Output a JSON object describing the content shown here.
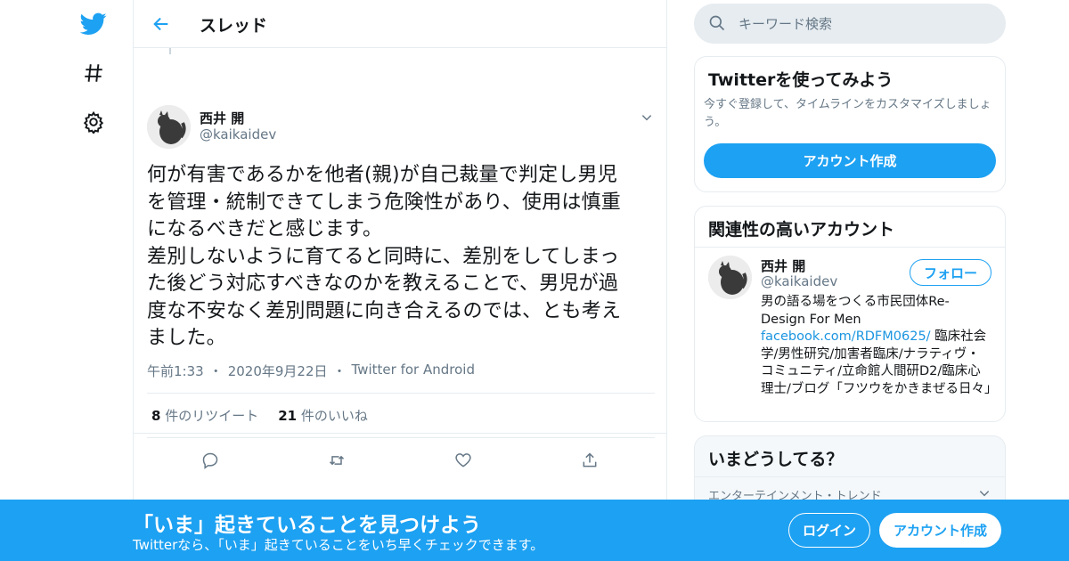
{
  "header": {
    "title": "スレッド"
  },
  "nav": {
    "icons": [
      "twitter-bird-icon",
      "hashtag-icon",
      "settings-gear-icon"
    ]
  },
  "tweet": {
    "author_name": "西井 開",
    "author_handle": "@kaikaidev",
    "text": "何が有害であるかを他者(親)が自己裁量で判定し男児\nを管理・統制できてしまう危険性があり、使用は慎重\nになるべきだと感じます。\n差別しないように育てると同時に、差別をしてしまっ\nた後どう対応すべきなのかを教えることで、男児が過\n度な不安なく差別問題に向き合えるのでは、とも考え\nました。",
    "time": "午前1:33",
    "date": "2020年9月22日",
    "source": "Twitter for Android",
    "sep": "・",
    "retweet_count": "8",
    "retweet_label": "件のリツイート",
    "like_count": "21",
    "like_label": "件のいいね"
  },
  "search": {
    "placeholder": "キーワード検索"
  },
  "signup_card": {
    "title": "Twitterを使ってみよう",
    "subtitle": "今すぐ登録して、タイムラインをカスタマイズしましょう。",
    "button": "アカウント作成"
  },
  "related": {
    "title": "関連性の高いアカウント",
    "name": "西井 開",
    "handle": "@kaikaidev",
    "follow_label": "フォロー",
    "bio_pre": "男の語る場をつくる市民団体Re-Design For Men",
    "bio_link": "facebook.com/RDFM0625/",
    "bio_post": " 臨床社会学/男性研究/加害者臨床/ナラティヴ・コミュニティ/立命館人間研D2/臨床心理士/ブログ「フツウをかきまぜる日々」"
  },
  "trends": {
    "title": "いまどうしてる？",
    "first_label": "エンターテインメント・トレンド"
  },
  "bottom_bar": {
    "title": "「いま」起きていることを見つけよう",
    "subtitle": "Twitterなら、「いま」起きていることをいち早くチェックできます。",
    "login": "ログイン",
    "signup": "アカウント作成"
  },
  "colors": {
    "brand": "#1da1f2",
    "text": "#14171a",
    "secondary": "#657786",
    "border": "#e6ecf0"
  }
}
